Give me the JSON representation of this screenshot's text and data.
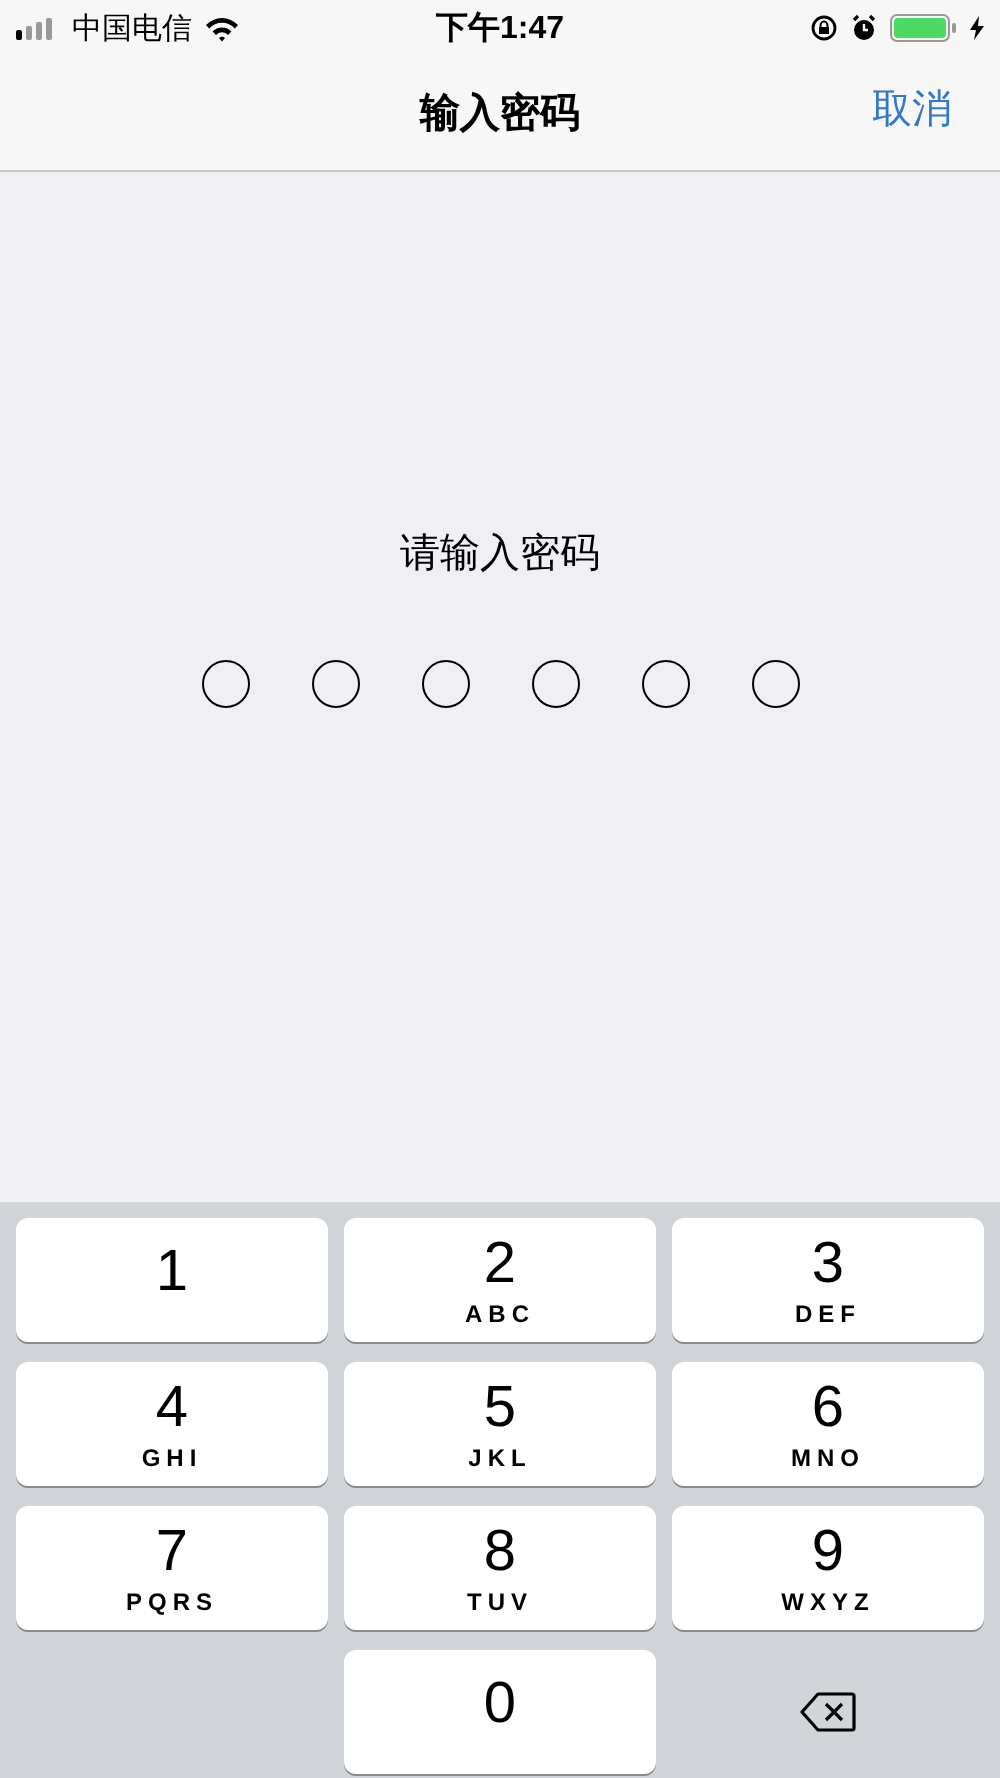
{
  "status_bar": {
    "carrier": "中国电信",
    "time": "下午1:47"
  },
  "nav": {
    "title": "输入密码",
    "cancel": "取消"
  },
  "prompt": "请输入密码",
  "passcode": [
    {
      "filled": false
    },
    {
      "filled": false
    },
    {
      "filled": false
    },
    {
      "filled": false
    },
    {
      "filled": false
    },
    {
      "filled": false
    }
  ],
  "keys": [
    {
      "kind": "digit",
      "digit": "1"
    },
    {
      "kind": "digit",
      "digit": "2",
      "letters": "ABC"
    },
    {
      "kind": "digit",
      "digit": "3",
      "letters": "DEF"
    },
    {
      "kind": "digit",
      "digit": "4",
      "letters": "GHI"
    },
    {
      "kind": "digit",
      "digit": "5",
      "letters": "JKL"
    },
    {
      "kind": "digit",
      "digit": "6",
      "letters": "MNO"
    },
    {
      "kind": "digit",
      "digit": "7",
      "letters": "PQRS"
    },
    {
      "kind": "digit",
      "digit": "8",
      "letters": "TUV"
    },
    {
      "kind": "digit",
      "digit": "9",
      "letters": "WXYZ"
    },
    {
      "kind": "digit",
      "digit": "0"
    },
    {
      "kind": "delete"
    }
  ]
}
